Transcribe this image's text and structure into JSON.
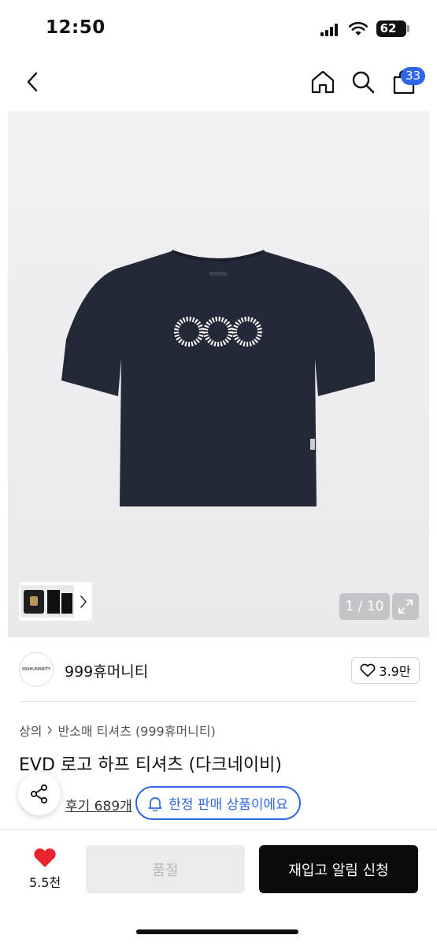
{
  "status_bar": {
    "time": "12:50",
    "battery": "62"
  },
  "header": {
    "cart_count": "33"
  },
  "gallery": {
    "counter": "1 / 10"
  },
  "brand": {
    "logo_text": "999HUMANITY",
    "name": "999휴머니티",
    "likes": "3.9만"
  },
  "breadcrumb": {
    "category": "상의",
    "subcategory": "반소매 티셔츠 (999휴머니티)"
  },
  "product": {
    "title": "EVD 로고 하프 티셔츠 (다크네이비)",
    "rating": "5",
    "reviews": "후기 689개",
    "limited_badge": "한정 판매 상품이에요"
  },
  "bottom_bar": {
    "wish_count": "5.5천",
    "soldout_label": "품절",
    "restock_label": "재입고 알림 신청"
  },
  "colors": {
    "accent": "#2f66e8",
    "heart": "#e8242f",
    "shirt": "#232936"
  }
}
